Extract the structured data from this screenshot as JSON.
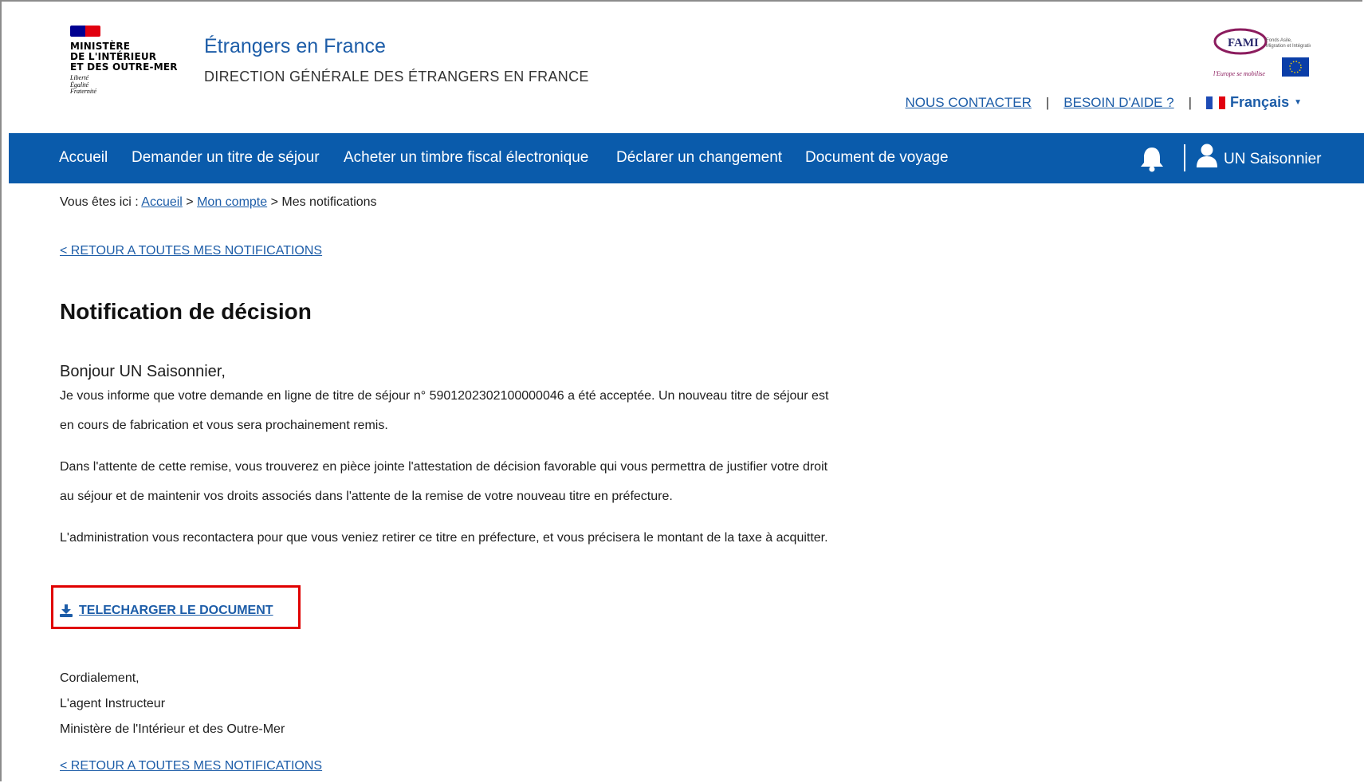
{
  "header": {
    "ministry_lines": [
      "MINISTÈRE",
      "DE L'INTÉRIEUR",
      "ET DES OUTRE-MER"
    ],
    "motto_lines": [
      "Liberté",
      "Égalité",
      "Fraternité"
    ],
    "site_title": "Étrangers en France",
    "site_subtitle": "DIRECTION GÉNÉRALE DES ÉTRANGERS EN FRANCE",
    "fami_logo_text": "FAMI",
    "fami_tagline": "l'Europe se mobilise",
    "contact_label": "NOUS CONTACTER",
    "help_label": "BESOIN D'AIDE ?",
    "separator": "|",
    "language_label": "Français"
  },
  "nav": {
    "items": [
      "Accueil",
      "Demander un titre de séjour",
      "Acheter un timbre fiscal électronique",
      "Déclarer un changement",
      "Document de voyage"
    ],
    "user_name": "UN Saisonnier"
  },
  "breadcrumb": {
    "prefix": "Vous êtes ici : ",
    "home": "Accueil",
    "sep": " > ",
    "account": "Mon compte",
    "current": "Mes notifications"
  },
  "back_link_label": "< RETOUR A TOUTES MES NOTIFICATIONS",
  "notification": {
    "title": "Notification de décision",
    "greeting": "Bonjour UN Saisonnier,",
    "paragraphs": [
      "Je vous informe que votre demande en ligne de titre de séjour n° 5901202302100000046 a été acceptée. Un nouveau titre de séjour est en cours de fabrication et vous sera prochainement remis.",
      "Dans l'attente de cette remise, vous trouverez en pièce jointe l'attestation de décision favorable qui vous permettra de justifier votre droit au séjour et de maintenir vos droits associés dans l'attente de la remise de votre nouveau titre en préfecture.",
      "L'administration vous recontactera pour que vous veniez retirer ce titre en préfecture, et vous précisera le montant de la taxe à acquitter."
    ],
    "download_label": "TELECHARGER LE DOCUMENT",
    "signature": [
      "Cordialement,",
      "L'agent Instructeur",
      "Ministère de l'Intérieur et des Outre-Mer"
    ]
  },
  "colors": {
    "nav_bg": "#0a5bab",
    "link": "#1d5da8",
    "highlight_box": "#e00000"
  }
}
